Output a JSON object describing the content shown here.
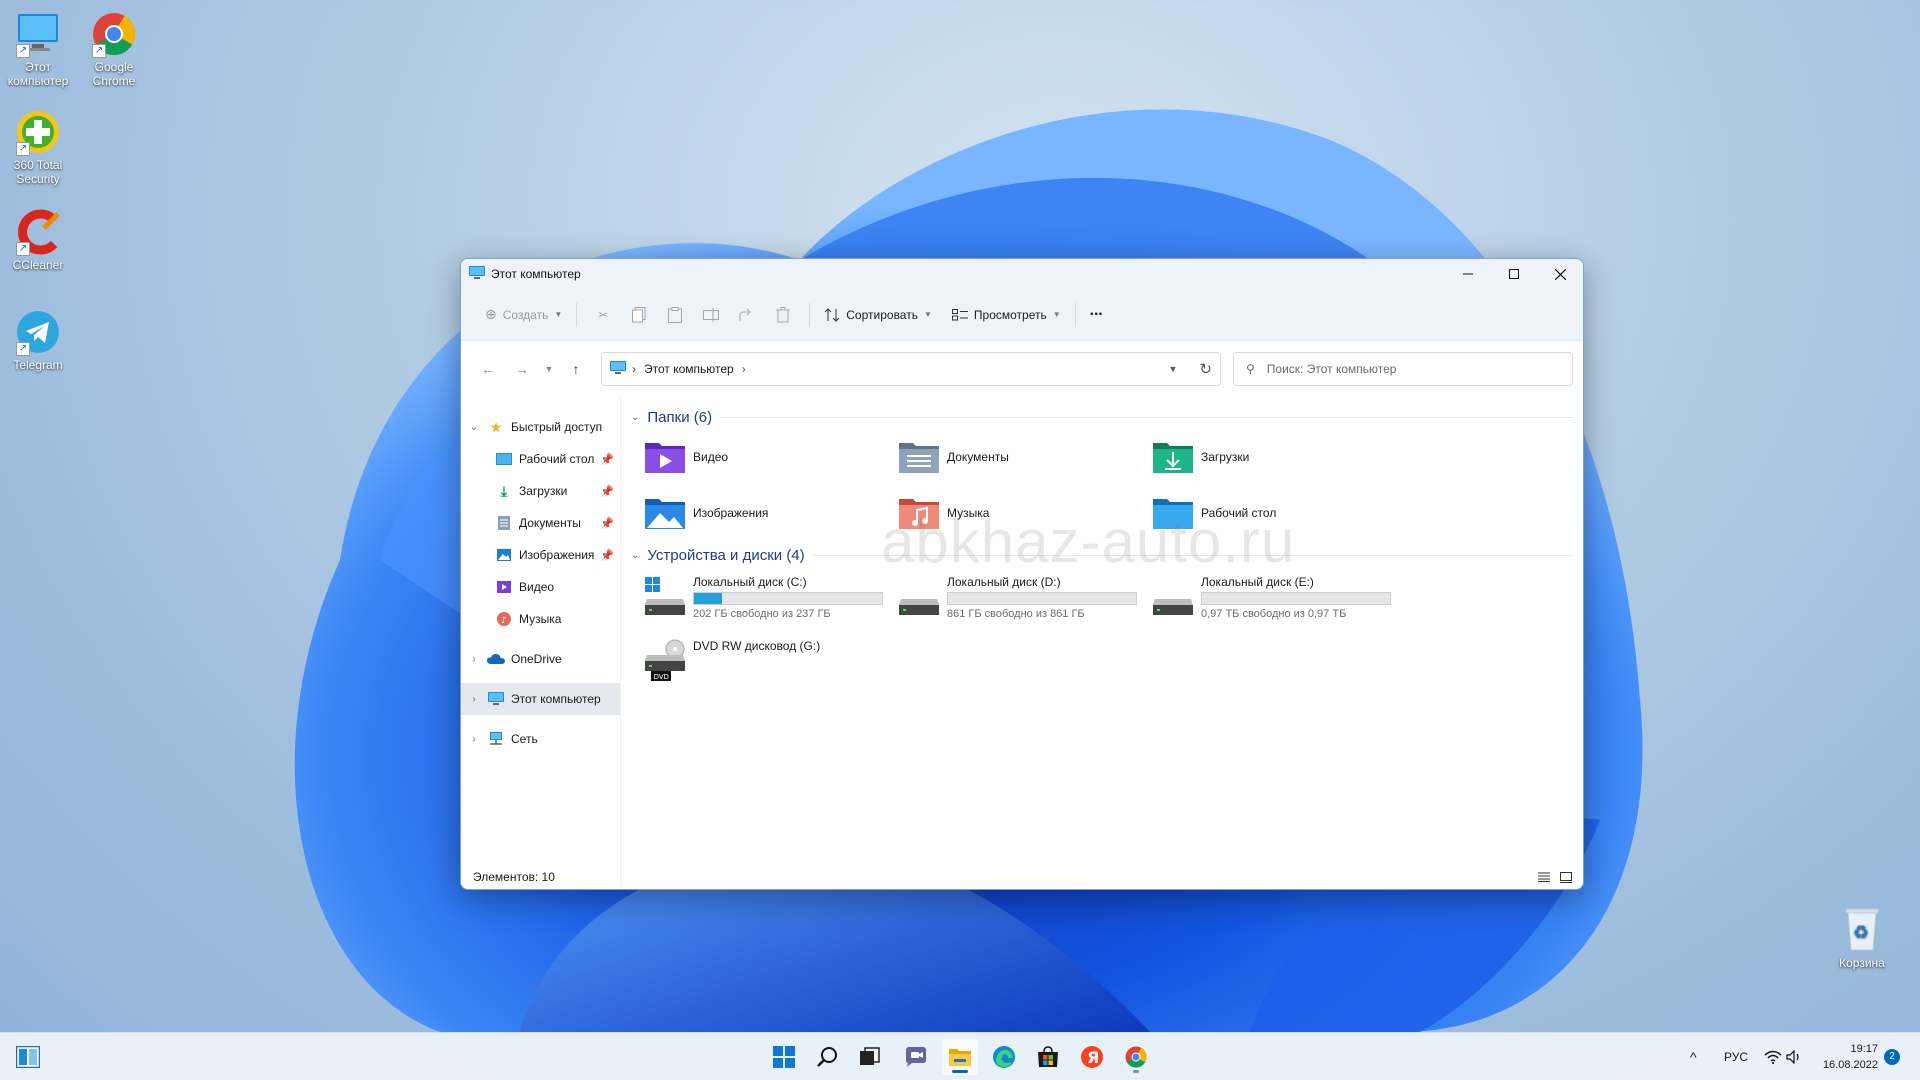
{
  "desktop": {
    "icons": [
      {
        "label": "Этот компьютер"
      },
      {
        "label": "Google Chrome"
      },
      {
        "label": "360 Total Security"
      },
      {
        "label": "CCleaner"
      },
      {
        "label": "Telegram"
      }
    ],
    "recycle_bin": "Корзина",
    "watermark": "abkhaz-auto.ru"
  },
  "window": {
    "title": "Этот компьютер",
    "command_bar": {
      "create": "Создать",
      "sort": "Сортировать",
      "view": "Просмотреть",
      "more": "···"
    },
    "address": {
      "path": "Этот компьютер",
      "search_placeholder": "Поиск: Этот компьютер"
    },
    "nav": {
      "quick_access": "Быстрый доступ",
      "quick_items": [
        "Рабочий стол",
        "Загрузки",
        "Документы",
        "Изображения",
        "Видео",
        "Музыка"
      ],
      "onedrive": "OneDrive",
      "this_pc": "Этот компьютер",
      "network": "Сеть"
    },
    "folders_header": "Папки (6)",
    "folders": [
      "Видео",
      "Документы",
      "Загрузки",
      "Изображения",
      "Музыка",
      "Рабочий стол"
    ],
    "drives_header": "Устройства и диски (4)",
    "drives": [
      {
        "name": "Локальный диск (C:)",
        "free": "202 ГБ свободно из 237 ГБ",
        "used_fraction": 0.15
      },
      {
        "name": "Локальный диск (D:)",
        "free": "861 ГБ свободно из 861 ГБ",
        "used_fraction": 0.0
      },
      {
        "name": "Локальный диск (E:)",
        "free": "0,97 ТБ свободно из 0,97 ТБ",
        "used_fraction": 0.0
      },
      {
        "name": "DVD RW дисковод (G:)",
        "dvd_label": "DVD"
      }
    ],
    "status": "Элементов: 10"
  },
  "taskbar": {
    "lang": "РУС",
    "time": "19:17",
    "date": "16.08.2022",
    "notifications": "2"
  },
  "colors": {
    "accent": "#0067c0",
    "drive_fill": "#26a0da",
    "group_header": "#1d3f8a"
  }
}
